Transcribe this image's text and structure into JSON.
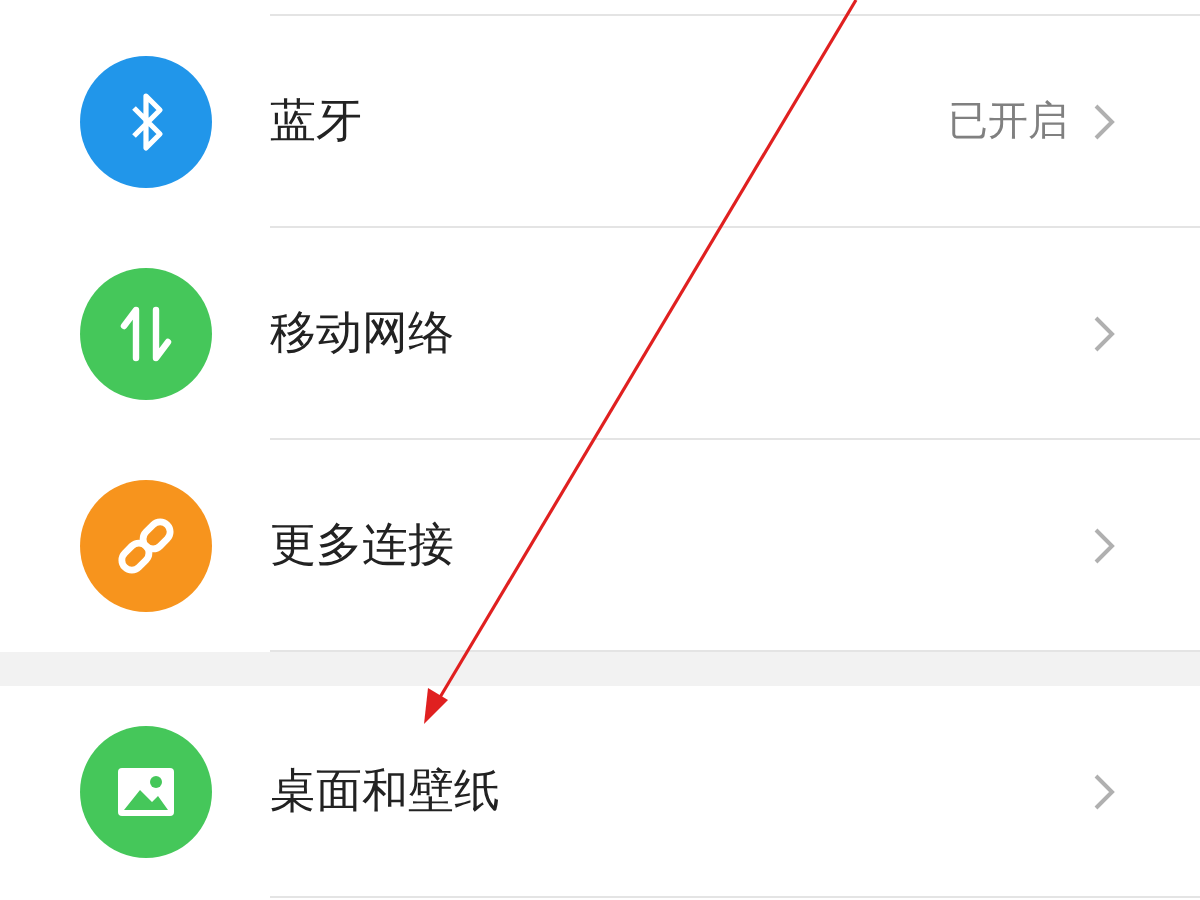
{
  "sections": [
    {
      "items": [
        {
          "title": "蓝牙",
          "value": "已开启",
          "kind": "bluetooth",
          "color": "#2196ea"
        },
        {
          "title": "移动网络",
          "kind": "updown",
          "color": "#45c75a"
        },
        {
          "title": "更多连接",
          "kind": "link",
          "color": "#f7941d"
        }
      ]
    },
    {
      "items": [
        {
          "title": "桌面和壁纸",
          "kind": "image",
          "color": "#45c75a"
        }
      ]
    }
  ]
}
